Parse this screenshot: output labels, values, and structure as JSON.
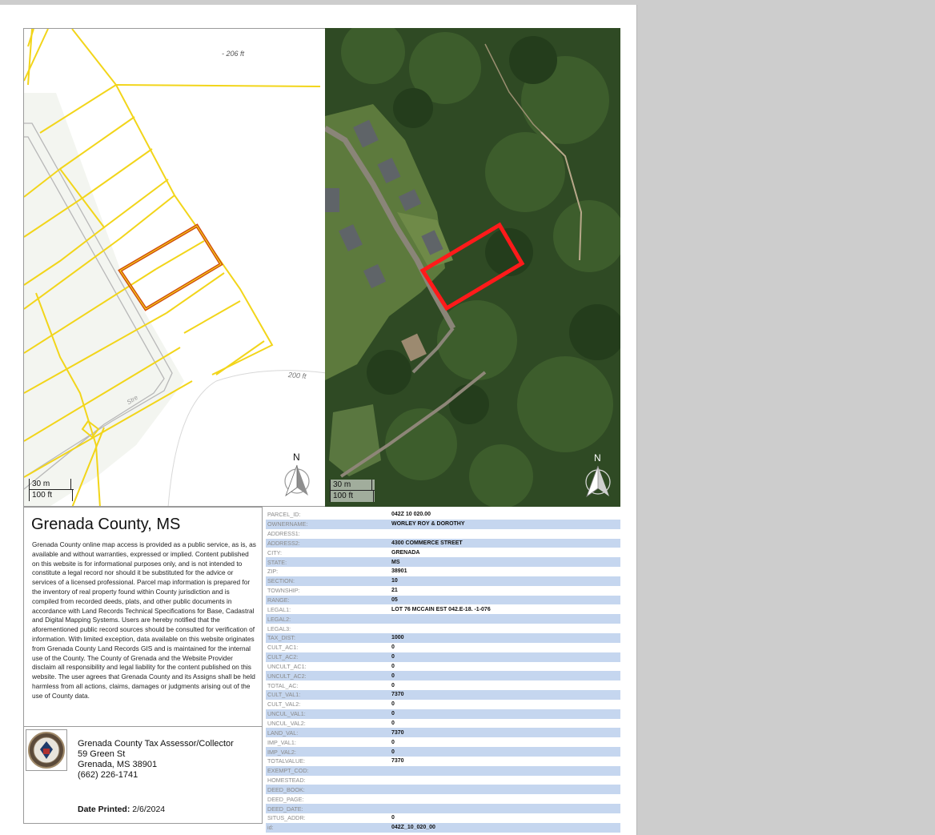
{
  "left_map": {
    "distance_top": "- 206 ft",
    "distance_right": "200 ft",
    "road_label": "Stre",
    "scale_metric": "30 m",
    "scale_imperial": "100 ft",
    "north_label": "N",
    "colors": {
      "parcel_lines": "#f2d51a",
      "selected_parcel": "#d14a0c"
    }
  },
  "right_map": {
    "scale_metric": "30 m",
    "scale_imperial": "100 ft",
    "north_label": "N",
    "colors": {
      "selected_parcel": "#ff1a1a",
      "vegetation": "#2f4a24"
    }
  },
  "info": {
    "title": "Grenada County, MS",
    "disclaimer": "Grenada County online map access is provided as a public service, as is, as available and without warranties, expressed or implied. Content published on this website is for informational purposes only, and is not intended to constitute a legal record nor should it be substituted for the advice or services of a licensed professional. Parcel map information is prepared for the inventory of real property found within County jurisdiction and is compiled from recorded deeds, plats, and other public documents in accordance with Land Records Technical Specifications for Base, Cadastral and Digital Mapping Systems. Users are hereby notified that the aforementioned public record sources should be consulted for verification of information. With limited exception, data available on this website originates from Grenada County Land Records GIS and is maintained for the internal use of the County. The County of Grenada and the Website Provider disclaim all responsibility and legal liability for the content published on this website. The user agrees that Grenada County and its Assigns shall be held harmless from all actions, claims, damages or judgments arising out of the use of County data.",
    "office_name": "Grenada County Tax Assessor/Collector",
    "office_street": "59 Green St",
    "office_city": "Grenada, MS 38901",
    "office_phone": "(662) 226-1741",
    "printed_label": "Date Printed:",
    "printed_date": "2/6/2024"
  },
  "attributes": [
    {
      "key": "PARCEL_ID:",
      "value": "042Z 10 020.00"
    },
    {
      "key": "OWNERNAME:",
      "value": "WORLEY ROY & DOROTHY"
    },
    {
      "key": "ADDRESS1:",
      "value": ""
    },
    {
      "key": "ADDRESS2:",
      "value": "4300 COMMERCE STREET"
    },
    {
      "key": "CITY:",
      "value": "GRENADA"
    },
    {
      "key": "STATE:",
      "value": "MS"
    },
    {
      "key": "ZIP:",
      "value": "38901"
    },
    {
      "key": "SECTION:",
      "value": "10"
    },
    {
      "key": "TOWNSHIP:",
      "value": "21"
    },
    {
      "key": "RANGE:",
      "value": "05"
    },
    {
      "key": "LEGAL1:",
      "value": "LOT 76 MCCAIN EST 042.E-18. -1-076"
    },
    {
      "key": "LEGAL2:",
      "value": ""
    },
    {
      "key": "LEGAL3:",
      "value": ""
    },
    {
      "key": "TAX_DIST:",
      "value": "1000"
    },
    {
      "key": "CULT_AC1:",
      "value": "0"
    },
    {
      "key": "CULT_AC2:",
      "value": "0"
    },
    {
      "key": "UNCULT_AC1:",
      "value": "0"
    },
    {
      "key": "UNCULT_AC2:",
      "value": "0"
    },
    {
      "key": "TOTAL_AC:",
      "value": "0"
    },
    {
      "key": "CULT_VAL1:",
      "value": "7370"
    },
    {
      "key": "CULT_VAL2:",
      "value": "0"
    },
    {
      "key": "UNCUL_VAL1:",
      "value": "0"
    },
    {
      "key": "UNCUL_VAL2:",
      "value": "0"
    },
    {
      "key": "LAND_VAL:",
      "value": "7370"
    },
    {
      "key": "IMP_VAL1:",
      "value": "0"
    },
    {
      "key": "IMP_VAL2:",
      "value": "0"
    },
    {
      "key": "TOTALVALUE:",
      "value": "7370"
    },
    {
      "key": "EXEMPT_COD:",
      "value": ""
    },
    {
      "key": "HOMESTEAD:",
      "value": ""
    },
    {
      "key": "DEED_BOOK:",
      "value": ""
    },
    {
      "key": "DEED_PAGE:",
      "value": ""
    },
    {
      "key": "DEED_DATE:",
      "value": ""
    },
    {
      "key": "SITUS_ADDR:",
      "value": "0"
    },
    {
      "key": "id:",
      "value": "042Z_10_020_00"
    }
  ]
}
